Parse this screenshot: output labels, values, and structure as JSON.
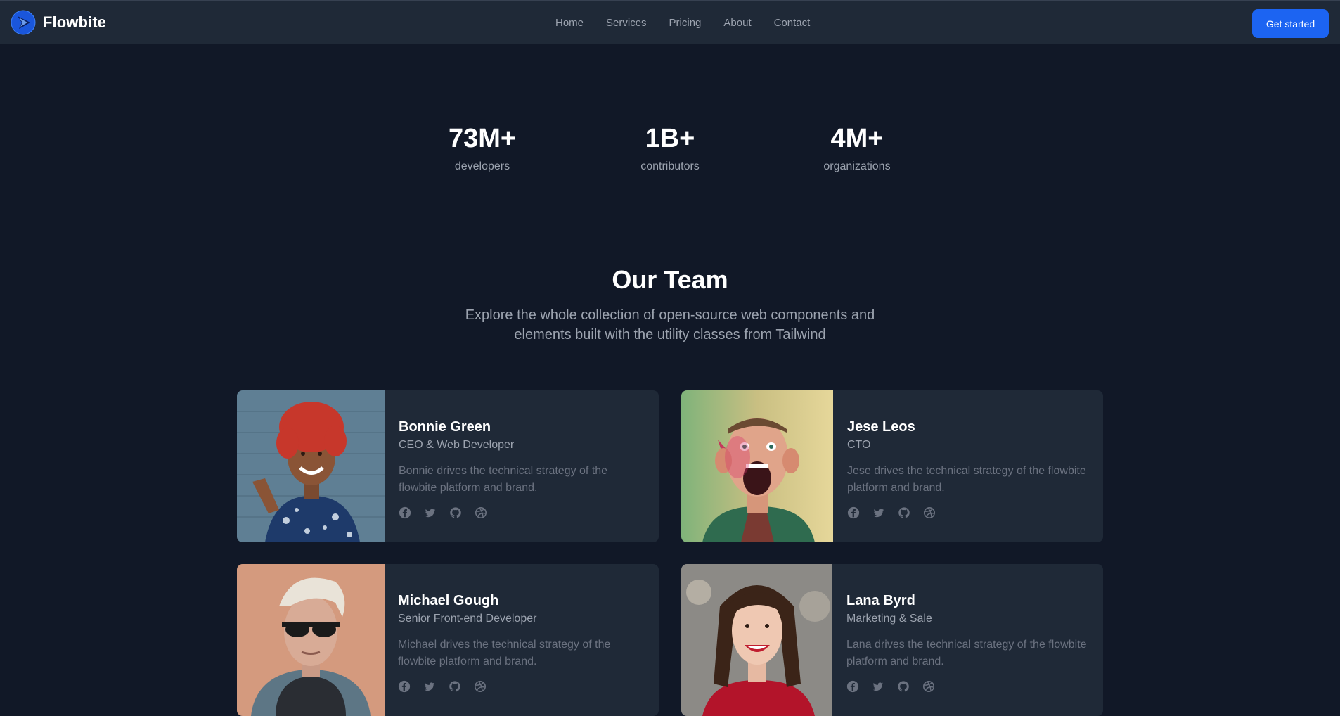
{
  "brand": {
    "name": "Flowbite"
  },
  "nav": {
    "links": [
      "Home",
      "Services",
      "Pricing",
      "About",
      "Contact"
    ],
    "cta": "Get started"
  },
  "stats": [
    {
      "value": "73M+",
      "label": "developers"
    },
    {
      "value": "1B+",
      "label": "contributors"
    },
    {
      "value": "4M+",
      "label": "organizations"
    }
  ],
  "team": {
    "title": "Our Team",
    "subtitle": "Explore the whole collection of open-source web components and elements built with the utility classes from Tailwind",
    "members": [
      {
        "name": "Bonnie Green",
        "role": "CEO & Web Developer",
        "bio": "Bonnie drives the technical strategy of the flowbite platform and brand."
      },
      {
        "name": "Jese Leos",
        "role": "CTO",
        "bio": "Jese drives the technical strategy of the flowbite platform and brand."
      },
      {
        "name": "Michael Gough",
        "role": "Senior Front-end Developer",
        "bio": "Michael drives the technical strategy of the flowbite platform and brand."
      },
      {
        "name": "Lana Byrd",
        "role": "Marketing & Sale",
        "bio": "Lana drives the technical strategy of the flowbite platform and brand."
      }
    ],
    "social_icons": [
      "facebook-icon",
      "twitter-icon",
      "github-icon",
      "dribbble-icon"
    ]
  },
  "colors": {
    "background": "#111827",
    "surface": "#1f2937",
    "accent": "#1c64f2",
    "muted_text": "#9ca3af"
  }
}
